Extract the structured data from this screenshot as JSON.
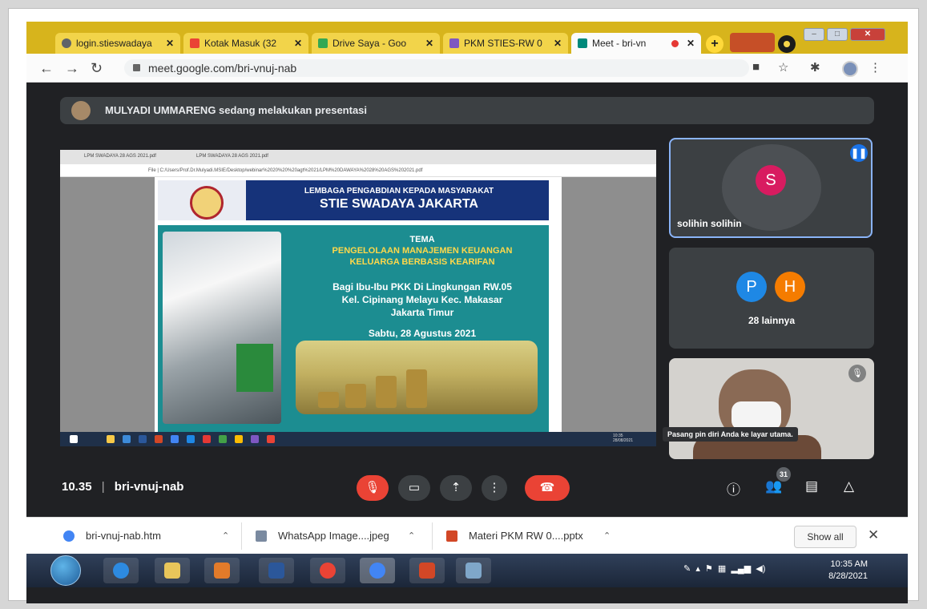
{
  "browser": {
    "tabs": [
      {
        "label": "login.stieswadaya",
        "icon": "globe-icon",
        "color": "#5f6368"
      },
      {
        "label": "Kotak Masuk (32",
        "icon": "gmail-icon",
        "color": "#ea4335"
      },
      {
        "label": "Drive Saya - Goo",
        "icon": "drive-icon",
        "color": "#34a853"
      },
      {
        "label": "PKM STIES-RW 0",
        "icon": "slides-icon",
        "color": "#7e57c2"
      },
      {
        "label": "Meet - bri-vn",
        "icon": "meet-icon",
        "color": "#00897b"
      }
    ],
    "tab_close_glyph": "✕",
    "new_tab_glyph": "+",
    "url": "meet.google.com/bri-vnuj-nab"
  },
  "meet": {
    "presenter_banner": "MULYADI UMMARENG sedang melakukan presentasi",
    "participants": [
      {
        "name": "solihin solihin",
        "initial": "S",
        "color": "#d81b60"
      }
    ],
    "more_tile": {
      "initials": [
        "P",
        "H"
      ],
      "label": "28 lainnya"
    },
    "pin_tooltip": "Pasang pin diri Anda ke layar utama.",
    "meeting_time": "10.35",
    "meeting_code": "bri-vnuj-nab",
    "people_count": "31"
  },
  "shared_screen": {
    "inner_tabs": [
      "LPM SWADAYA 28 AGS 2021.pdf",
      "LPM SWADAYA 28 AGS 2021.pdf"
    ],
    "inner_url": "File | C:/Users/Prof.Dr.Mulyadi.MSIE/Desktop/webinar%2020%20%20agt%2021/LPM%20DAWAYA%2028%20AGS%202021.pdf",
    "slide": {
      "header_line1": "LEMBAGA PENGABDIAN KEPADA MASYARAKAT",
      "header_line2": "STIE SWADAYA JAKARTA",
      "tema": "TEMA",
      "theme_line1": "PENGELOLAAN MANAJEMEN KEUANGAN",
      "theme_line2": "KELUARGA BERBASIS KEARIFAN",
      "sub1": "Bagi Ibu-Ibu PKK Di Lingkungan RW.05",
      "sub2": "Kel. Cipinang Melayu Kec. Makasar",
      "sub3": "Jakarta Timur",
      "date": "Sabtu, 28 Agustus 2021"
    },
    "inner_clock": "10:35 28/08/2021"
  },
  "downloads": {
    "items": [
      {
        "label": "bri-vnuj-nab.htm",
        "color": "#4285f4"
      },
      {
        "label": "WhatsApp Image....jpeg",
        "color": "#7a8aa0"
      },
      {
        "label": "Materi PKM RW 0....pptx",
        "color": "#d24726"
      }
    ],
    "show_all": "Show all"
  },
  "taskbar": {
    "time": "10:35 AM",
    "date": "8/28/2021"
  }
}
